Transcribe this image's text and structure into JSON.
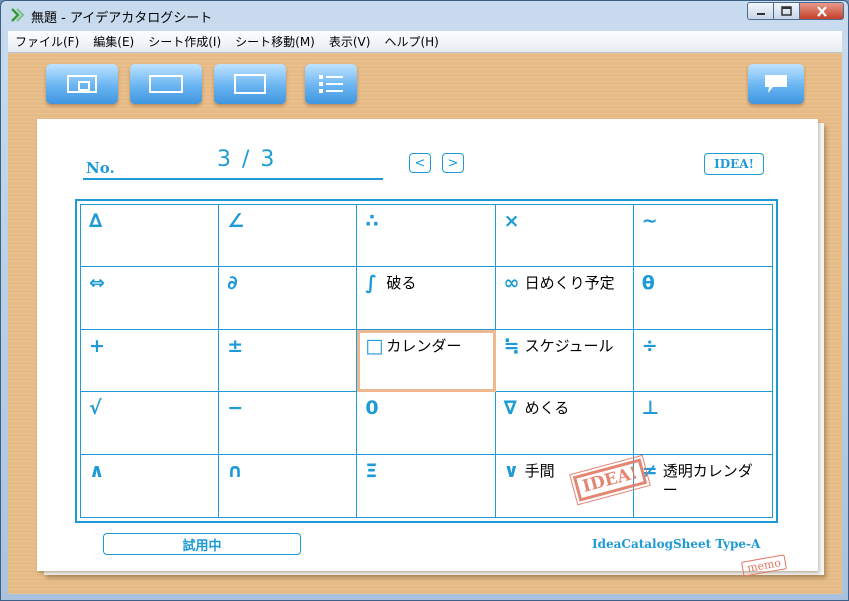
{
  "window": {
    "title": "無題 - アイデアカタログシート"
  },
  "menu": [
    "ファイル(F)",
    "編集(E)",
    "シート作成(I)",
    "シート移動(M)",
    "表示(V)",
    "ヘルプ(H)"
  ],
  "toolbar": {
    "buttons": [
      "view-card-small",
      "view-card-wide",
      "view-card-large",
      "view-list"
    ],
    "right_button": "comment"
  },
  "sheet": {
    "no_label": "No.",
    "page": "3 / 3",
    "prev": "<",
    "next": ">",
    "idea_button": "IDEA!",
    "cells": [
      {
        "sym": "∆",
        "text": ""
      },
      {
        "sym": "∠",
        "text": ""
      },
      {
        "sym": "∴",
        "text": ""
      },
      {
        "sym": "×",
        "text": ""
      },
      {
        "sym": "∼",
        "text": ""
      },
      {
        "sym": "⇔",
        "text": ""
      },
      {
        "sym": "∂",
        "text": ""
      },
      {
        "sym": "∫",
        "text": "破る"
      },
      {
        "sym": "∞",
        "text": "日めくり予定"
      },
      {
        "sym": "θ",
        "text": ""
      },
      {
        "sym": "+",
        "text": ""
      },
      {
        "sym": "±",
        "text": ""
      },
      {
        "sym": "□",
        "text": "カレンダー"
      },
      {
        "sym": "≒",
        "text": "スケジュール"
      },
      {
        "sym": "÷",
        "text": ""
      },
      {
        "sym": "√",
        "text": ""
      },
      {
        "sym": "−",
        "text": ""
      },
      {
        "sym": "0",
        "text": ""
      },
      {
        "sym": "∇",
        "text": "めくる"
      },
      {
        "sym": "⊥",
        "text": ""
      },
      {
        "sym": "∧",
        "text": ""
      },
      {
        "sym": "∩",
        "text": ""
      },
      {
        "sym": "Ξ",
        "text": ""
      },
      {
        "sym": "∨",
        "text": "手間"
      },
      {
        "sym": "≠",
        "text": "透明カレンダー"
      }
    ],
    "selected_index": 12,
    "stamp_idea": "IDEA!",
    "stamp_memo": "memo",
    "status": "試用中",
    "footer": "IdeaCatalogSheet Type-A"
  },
  "colors": {
    "accent": "#1e9ad6",
    "paper_bg": "#e6bb86",
    "stamp": "#e07a66"
  }
}
